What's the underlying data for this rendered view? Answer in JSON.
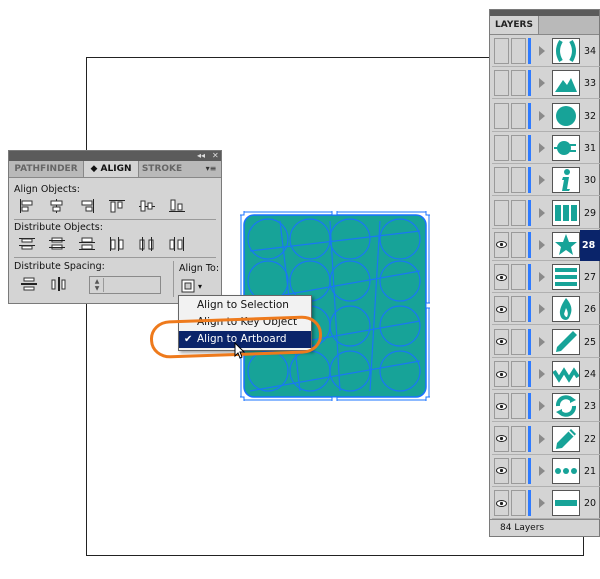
{
  "colors": {
    "teal": "#17a398",
    "selection_blue": "#1a73ff",
    "menu_highlight": "#0a246a",
    "annotation_orange": "#ee7a1c"
  },
  "align_panel": {
    "tabs": [
      {
        "label": "PATHFINDER"
      },
      {
        "label": "◆ ALIGN"
      },
      {
        "label": "STROKE"
      }
    ],
    "align_objects_label": "Align Objects:",
    "distribute_objects_label": "Distribute Objects:",
    "distribute_spacing_label": "Distribute Spacing:",
    "align_to_label": "Align To:"
  },
  "dropdown": {
    "items": [
      {
        "label": "Align to Selection",
        "selected": false
      },
      {
        "label": "Align to Key Object",
        "selected": false
      },
      {
        "label": "Align to Artboard",
        "selected": true
      }
    ]
  },
  "layers_panel": {
    "tab_label": "LAYERS",
    "footer": "84 Layers",
    "layers": [
      {
        "name": "34",
        "icon": "parentheses-icon",
        "visible": false,
        "active": false
      },
      {
        "name": "33",
        "icon": "mountain-icon",
        "visible": false,
        "active": false
      },
      {
        "name": "32",
        "icon": "circle-icon",
        "visible": false,
        "active": false
      },
      {
        "name": "31",
        "icon": "plug-icon",
        "visible": false,
        "active": false
      },
      {
        "name": "30",
        "icon": "info-icon",
        "visible": false,
        "active": false
      },
      {
        "name": "29",
        "icon": "columns-icon",
        "visible": false,
        "active": false
      },
      {
        "name": "28",
        "icon": "star-icon",
        "visible": true,
        "active": true
      },
      {
        "name": "27",
        "icon": "menu-lines-icon",
        "visible": true,
        "active": false
      },
      {
        "name": "26",
        "icon": "flame-icon",
        "visible": true,
        "active": false
      },
      {
        "name": "25",
        "icon": "pen-line-icon",
        "visible": true,
        "active": false
      },
      {
        "name": "24",
        "icon": "zigzag-icon",
        "visible": true,
        "active": false
      },
      {
        "name": "23",
        "icon": "refresh-icon",
        "visible": true,
        "active": false
      },
      {
        "name": "22",
        "icon": "pencil-icon",
        "visible": true,
        "active": false
      },
      {
        "name": "21",
        "icon": "dots-icon",
        "visible": true,
        "active": false
      },
      {
        "name": "20",
        "icon": "minus-bar-icon",
        "visible": true,
        "active": false
      }
    ]
  }
}
